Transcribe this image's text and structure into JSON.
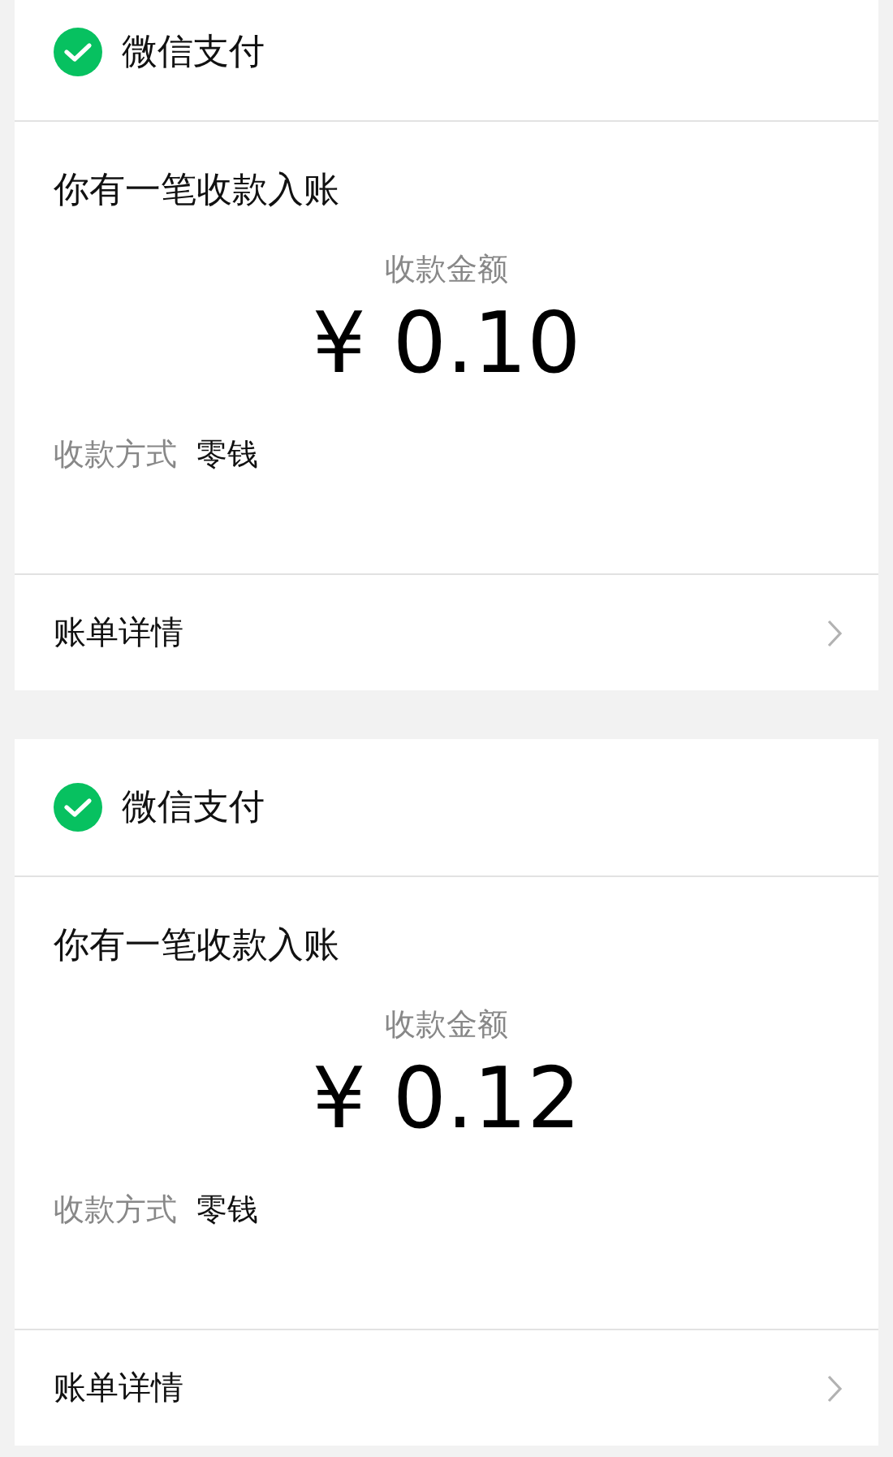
{
  "messages": [
    {
      "app_name": "微信支付",
      "title": "你有一笔收款入账",
      "amount_label": "收款金额",
      "amount": "¥ 0.10",
      "method_label": "收款方式",
      "method": "零钱",
      "detail_link": "账单详情"
    },
    {
      "app_name": "微信支付",
      "title": "你有一笔收款入账",
      "amount_label": "收款金额",
      "amount": "¥ 0.12",
      "method_label": "收款方式",
      "method": "零钱",
      "detail_link": "账单详情"
    }
  ]
}
